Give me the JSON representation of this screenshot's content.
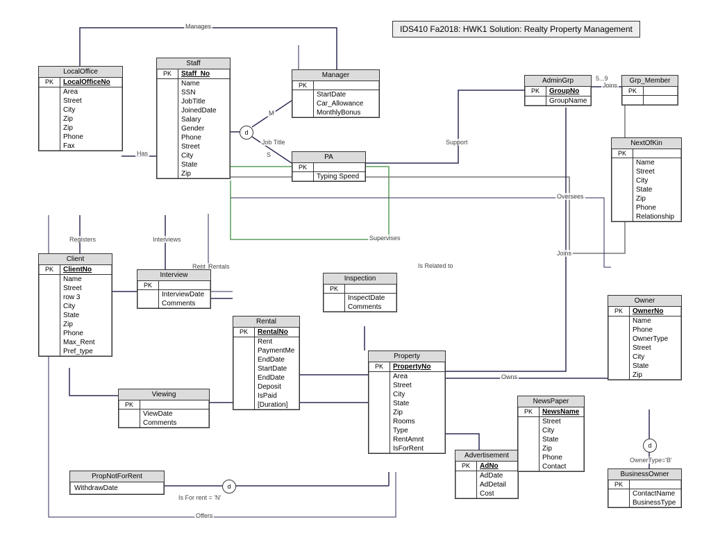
{
  "title": "IDS410 Fa2018: HWK1 Solution: Realty Property Management",
  "relationships": {
    "manages": "Manages",
    "has": "Has",
    "registers": "Registers",
    "interviews": "Interviews",
    "rent": "Rent",
    "rentals": "Rentals",
    "jobtitle": "Job Title",
    "support": "Support",
    "supervises": "Supervises",
    "joins": "Joins",
    "joins2": "Joins",
    "oversees": "Oversees",
    "isrelated": "Is Related to",
    "owns": "Owns",
    "offers": "Offers",
    "isforrent": "Is For rent = 'N'",
    "m": "M",
    "s": "S",
    "ownertype": "OwnerType='B'",
    "card59": "5...9"
  },
  "entities": {
    "localOffice": {
      "name": "LocalOffice",
      "pk": "LocalOfficeNo",
      "attrs": [
        "Area",
        "Street",
        "City",
        "Zip",
        "Zip",
        "Phone",
        "Fax"
      ]
    },
    "staff": {
      "name": "Staff",
      "pk": "Staff_No",
      "attrs": [
        "Name",
        "SSN",
        "JobTitle",
        "JoinedDate",
        "Salary",
        "Gender",
        "Phone",
        "Street",
        "City",
        "State",
        "Zip"
      ]
    },
    "manager": {
      "name": "Manager",
      "pk": "",
      "attrs": [
        "StartDate",
        "Car_Allowance",
        "MonthlyBonus"
      ]
    },
    "pa": {
      "name": "PA",
      "pk": "",
      "attrs": [
        "Typing Speed"
      ]
    },
    "adminGrp": {
      "name": "AdminGrp",
      "pk": "GroupNo",
      "attrs": [
        "GroupName"
      ]
    },
    "grpMember": {
      "name": "Grp_Member",
      "pk": "",
      "attrs": []
    },
    "nextOfKin": {
      "name": "NextOfKin",
      "pk": "",
      "attrs": [
        "Name",
        "Street",
        "City",
        "State",
        "Zip",
        "Phone",
        "Relationship"
      ]
    },
    "client": {
      "name": "Client",
      "pk": "ClientNo",
      "attrs": [
        "Name",
        "Street",
        "row 3",
        "City",
        "State",
        "Zip",
        "Phone",
        "Max_Rent",
        "Pref_type"
      ]
    },
    "interview": {
      "name": "Interview",
      "pk": "",
      "attrs": [
        "InterviewDate",
        "Comments"
      ]
    },
    "rental": {
      "name": "Rental",
      "pk": "RentalNo",
      "attrs": [
        "Rent",
        "PaymentMe",
        "EndDate",
        "StartDate",
        "EndDate",
        "Deposit",
        "IsPaid",
        "[Duration]"
      ]
    },
    "inspection": {
      "name": "Inspection",
      "pk": "",
      "attrs": [
        "InspectDate",
        "Comments"
      ]
    },
    "property": {
      "name": "Property",
      "pk": "PropertyNo",
      "attrs": [
        "Area",
        "Street",
        "City",
        "State",
        "Zip",
        "Rooms",
        "Type",
        "RentAmnt",
        "IsForRent"
      ]
    },
    "advertisement": {
      "name": "Advertisement",
      "pk": "AdNo",
      "attrs": [
        "AdDate",
        "AdDetail",
        "Cost"
      ]
    },
    "newspaper": {
      "name": "NewsPaper",
      "pk": "NewsName",
      "attrs": [
        "Street",
        "City",
        "State",
        "Zip",
        "Phone",
        "Contact"
      ]
    },
    "owner": {
      "name": "Owner",
      "pk": "OwnerNo",
      "attrs": [
        "Name",
        "Phone",
        "OwnerType",
        "Street",
        "City",
        "State",
        "Zip"
      ]
    },
    "businessOwner": {
      "name": "BusinessOwner",
      "pk": "",
      "attrs": [
        "ContactName",
        "BusinessType"
      ]
    },
    "viewing": {
      "name": "Viewing",
      "pk": "",
      "attrs": [
        "ViewDate",
        "Comments"
      ]
    },
    "propNotForRent": {
      "name": "PropNotForRent",
      "pk": "",
      "attrsFlat": [
        "WithdrawDate"
      ]
    }
  },
  "discriminators": {
    "d1": "d",
    "d2": "d",
    "d3": "d"
  }
}
